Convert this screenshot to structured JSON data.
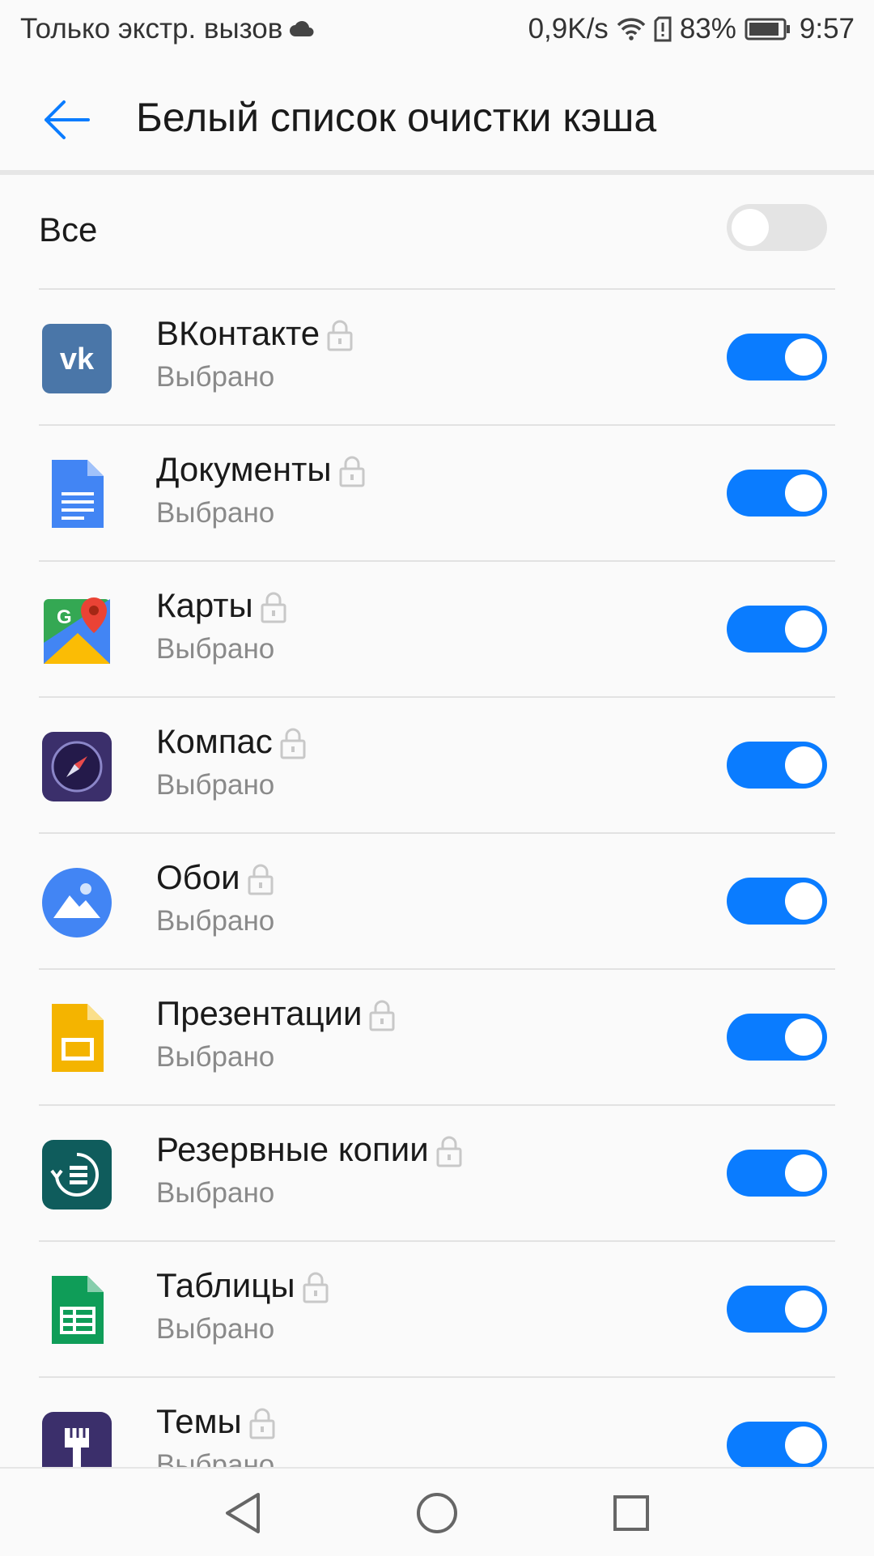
{
  "status_bar": {
    "carrier_text": "Только экстр. вызов",
    "speed": "0,9K/s",
    "battery": "83%",
    "time": "9:57"
  },
  "header": {
    "title": "Белый список очистки кэша"
  },
  "all_row": {
    "label": "Все",
    "enabled": false
  },
  "apps": [
    {
      "name": "ВКонтакте",
      "status": "Выбрано",
      "icon": "vk-icon",
      "enabled": true
    },
    {
      "name": "Документы",
      "status": "Выбрано",
      "icon": "docs-icon",
      "enabled": true
    },
    {
      "name": "Карты",
      "status": "Выбрано",
      "icon": "maps-icon",
      "enabled": true
    },
    {
      "name": "Компас",
      "status": "Выбрано",
      "icon": "compass-icon",
      "enabled": true
    },
    {
      "name": "Обои",
      "status": "Выбрано",
      "icon": "wallpapers-icon",
      "enabled": true
    },
    {
      "name": "Презентации",
      "status": "Выбрано",
      "icon": "slides-icon",
      "enabled": true
    },
    {
      "name": "Резервные копии",
      "status": "Выбрано",
      "icon": "backup-icon",
      "enabled": true
    },
    {
      "name": "Таблицы",
      "status": "Выбрано",
      "icon": "sheets-icon",
      "enabled": true
    },
    {
      "name": "Темы",
      "status": "Выбрано",
      "icon": "themes-icon",
      "enabled": true
    }
  ],
  "colors": {
    "accent": "#0a7cff",
    "toggle_off": "#e4e4e4",
    "secondary_text": "#8a8a8a"
  }
}
